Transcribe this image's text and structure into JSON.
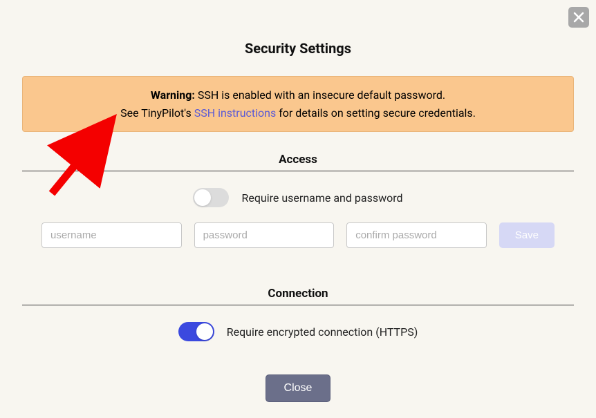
{
  "title": "Security Settings",
  "warning": {
    "label": "Warning:",
    "text1": " SSH is enabled with an insecure default password.",
    "text2a": "See TinyPilot's ",
    "link": "SSH instructions",
    "text2b": " for details on setting secure credentials."
  },
  "access": {
    "header": "Access",
    "toggle_label": "Require username and password",
    "username_placeholder": "username",
    "password_placeholder": "password",
    "confirm_placeholder": "confirm password",
    "save_label": "Save"
  },
  "connection": {
    "header": "Connection",
    "toggle_label": "Require encrypted connection (HTTPS)"
  },
  "close_label": "Close"
}
